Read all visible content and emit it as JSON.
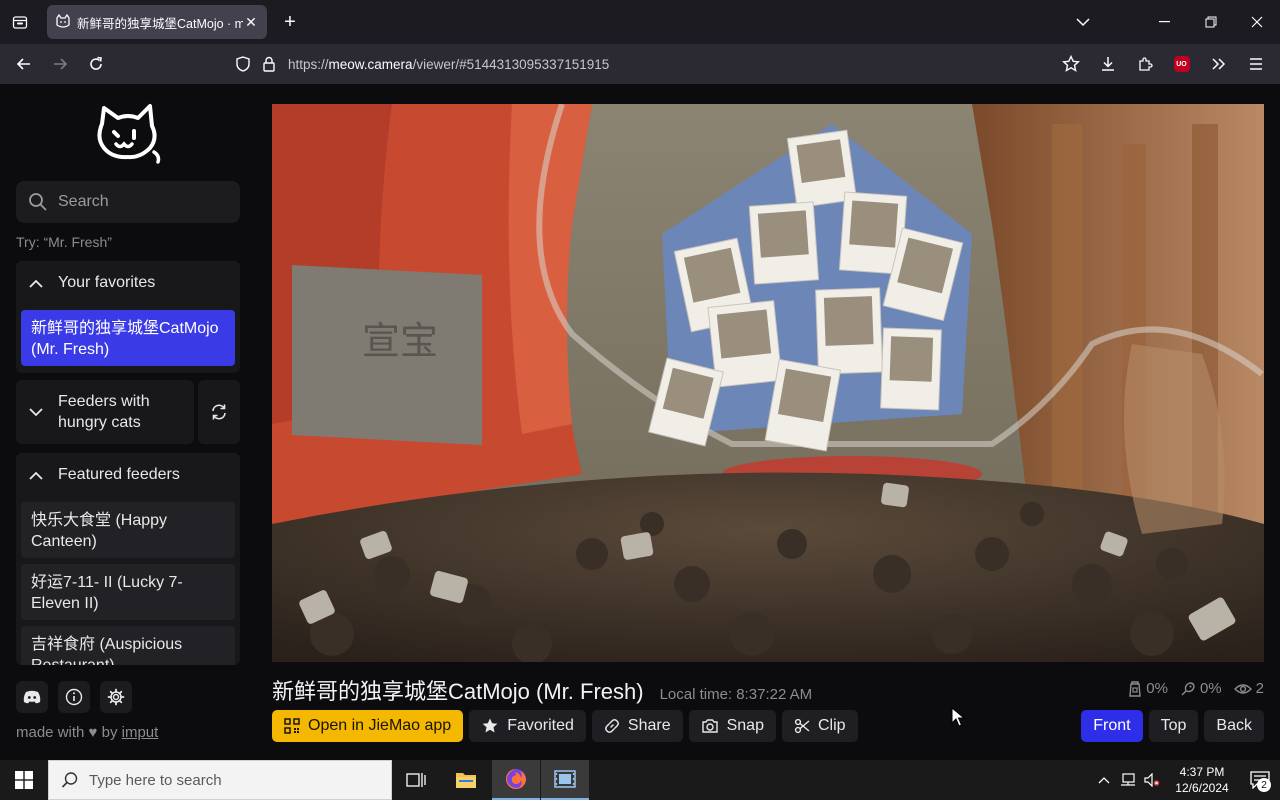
{
  "browser": {
    "tab_title": "新鲜哥的独享城堡CatMojo · meow.camera",
    "url_prefix": "https://",
    "url_host": "meow.camera",
    "url_path": "/viewer/#5144313095337151915"
  },
  "sidebar": {
    "search_placeholder": "Search",
    "try_hint": "Try: “Mr. Fresh”",
    "favorites": {
      "heading": "Your favorites",
      "items": [
        "新鲜哥的独享城堡CatMojo (Mr. Fresh)"
      ]
    },
    "hungry": {
      "heading": "Feeders with hungry cats"
    },
    "featured": {
      "heading": "Featured feeders",
      "items": [
        "快乐大食堂 (Happy Canteen)",
        "好运7-11- II  (Lucky 7-Eleven II)",
        "吉祥食府 (Auspicious Restaurant)"
      ]
    },
    "footer": {
      "made_with": "made with",
      "by": "by",
      "author": "imput"
    }
  },
  "viewer": {
    "title": "新鲜哥的独享城堡CatMojo (Mr. Fresh)",
    "local_time": "Local time: 8:37:22 AM",
    "stats": {
      "food": "0%",
      "treats": "0%",
      "viewers": "2"
    },
    "actions": {
      "open_app": "Open in JieMao app",
      "favorited": "Favorited",
      "share": "Share",
      "snap": "Snap",
      "clip": "Clip"
    },
    "views": {
      "front": "Front",
      "top": "Top",
      "back": "Back",
      "active": "Front"
    },
    "wall_sign": "宣宝"
  },
  "taskbar": {
    "search_placeholder": "Type here to search",
    "time": "4:37 PM",
    "date": "12/6/2024",
    "notifications": "2"
  },
  "colors": {
    "accent_blue": "#3a3ae6",
    "accent_yellow": "#f5b800"
  }
}
